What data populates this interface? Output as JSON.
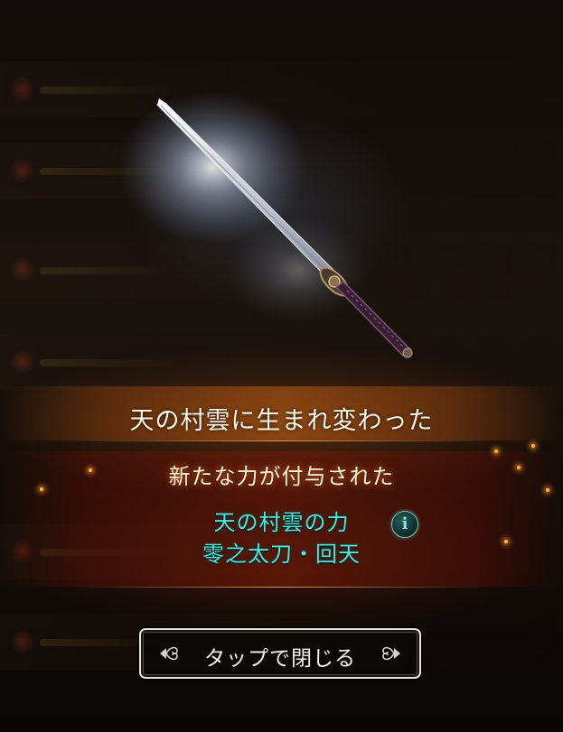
{
  "result": {
    "headline": "天の村雲に生まれ変わった",
    "subline": "新たな力が付与された"
  },
  "ability": {
    "name_line1": "天の村雲の力",
    "name_line2": "零之太刀・回天",
    "info_icon_label": "i"
  },
  "close_button": {
    "label": "タップで閉じる"
  },
  "icons": [
    "sword-item-icon",
    "info-icon",
    "ornament-arrow-left-icon",
    "ornament-arrow-right-icon"
  ],
  "colors": {
    "headline": "#fbf3e4",
    "subline_glow": "#ff7a1e",
    "ability_text": "#4fe6dc",
    "button_border": "#e9e4da"
  }
}
